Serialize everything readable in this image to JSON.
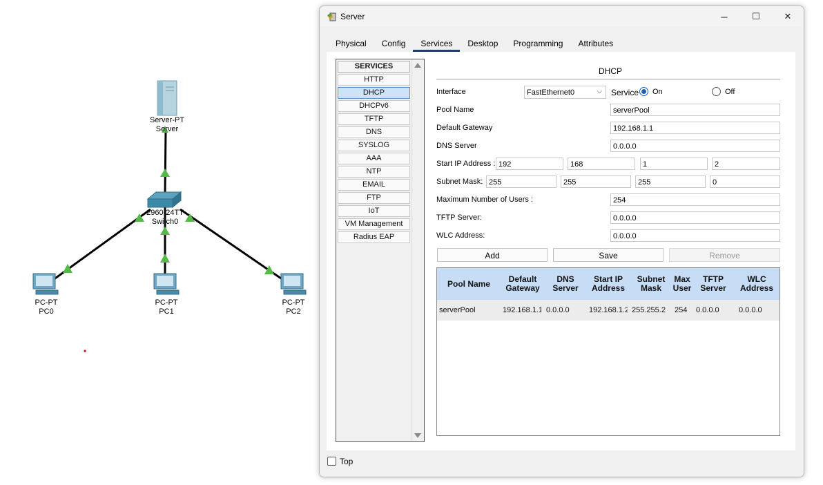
{
  "topology": {
    "devices": [
      {
        "type_label": "Server-PT",
        "name_label": "Server"
      },
      {
        "type_label": "2960-24TT",
        "name_label": "Switch0"
      },
      {
        "type_label": "PC-PT",
        "name_label": "PC0"
      },
      {
        "type_label": "PC-PT",
        "name_label": "PC1"
      },
      {
        "type_label": "PC-PT",
        "name_label": "PC2"
      }
    ],
    "link_color": "#000000",
    "link_status_color": "#55b94a"
  },
  "window": {
    "title": "Server",
    "controls": {
      "minimize": "─",
      "maximize": "☐",
      "close": "✕"
    }
  },
  "tabs": [
    "Physical",
    "Config",
    "Services",
    "Desktop",
    "Programming",
    "Attributes"
  ],
  "active_tab": "Services",
  "services": {
    "header": "SERVICES",
    "items": [
      "HTTP",
      "DHCP",
      "DHCPv6",
      "TFTP",
      "DNS",
      "SYSLOG",
      "AAA",
      "NTP",
      "EMAIL",
      "FTP",
      "IoT",
      "VM Management",
      "Radius EAP"
    ],
    "selected": "DHCP"
  },
  "dhcp": {
    "title": "DHCP",
    "interface_label": "Interface",
    "interface_value": "FastEthernet0",
    "service_label": "Service",
    "on_label": "On",
    "off_label": "Off",
    "service_state": "On",
    "pool_name_label": "Pool Name",
    "pool_name": "serverPool",
    "default_gateway_label": "Default Gateway",
    "default_gateway": "192.168.1.1",
    "dns_server_label": "DNS Server",
    "dns_server": "0.0.0.0",
    "start_ip_label": "Start IP Address :",
    "start_ip": [
      "192",
      "168",
      "1",
      "2"
    ],
    "subnet_mask_label": "Subnet Mask:",
    "subnet_mask": [
      "255",
      "255",
      "255",
      "0"
    ],
    "max_users_label": "Maximum Number of Users :",
    "max_users": "254",
    "tftp_server_label": "TFTP Server:",
    "tftp_server": "0.0.0.0",
    "wlc_address_label": "WLC Address:",
    "wlc_address": "0.0.0.0",
    "add_label": "Add",
    "save_label": "Save",
    "remove_label": "Remove"
  },
  "pool_table": {
    "headers": [
      "Pool Name",
      "Default Gateway",
      "DNS Server",
      "Start IP Address",
      "Subnet Mask",
      "Max User",
      "TFTP Server",
      "WLC Address"
    ],
    "rows": [
      [
        "serverPool",
        "192.168.1.1",
        "0.0.0.0",
        "192.168.1.2",
        "255.255.2",
        "254",
        "0.0.0.0",
        "0.0.0.0"
      ]
    ]
  },
  "footer": {
    "top_label": "Top"
  },
  "colors": {
    "accent": "#1a5fb4",
    "table_header": "#c7ddf5",
    "selected_service": "#cfe3f7"
  }
}
